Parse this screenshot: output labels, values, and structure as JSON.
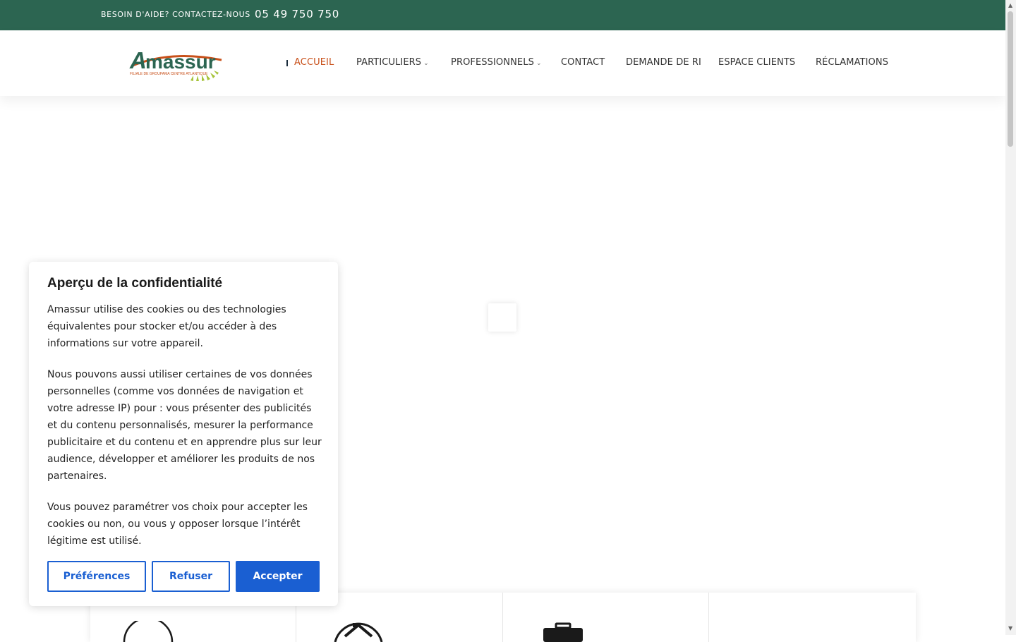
{
  "topbar": {
    "help_text": "BESOIN D'AIDE? CONTACTEZ-NOUS",
    "phone": "05 49 750 750"
  },
  "logo": {
    "name": "Amassur",
    "tagline": "FILIALE DE GROUPAMA CENTRE ATLANTIQUE"
  },
  "nav": {
    "items": [
      {
        "label": "ACCUEIL",
        "active": true
      },
      {
        "label": "PARTICULIERS",
        "dropdown": true
      },
      {
        "label": "PROFESSIONNELS",
        "dropdown": true
      },
      {
        "label": "CONTACT"
      },
      {
        "label": "DEMANDE DE RI"
      },
      {
        "label": "ESPACE CLIENTS"
      },
      {
        "label": "RÉCLAMATIONS"
      }
    ]
  },
  "cookie": {
    "title": "Aperçu de la confidentialité",
    "paragraph1": "Amassur utilise des cookies ou des technologies équivalentes pour stocker et/ou accéder à des informations sur votre appareil.",
    "paragraph2": "Nous pouvons aussi utiliser certaines de vos données personnelles (comme vos données de navigation et votre adresse IP) pour : vous présenter des publicités et du contenu personnalisés, mesurer la performance publicitaire et du contenu et en apprendre plus sur leur audience, développer et améliorer les produits de nos partenaires.",
    "paragraph3": "Vous pouvez paramétrer vos choix pour accepter les cookies ou non, ou vous y opposer lorsque l’intérêt légitime est utilisé.",
    "buttons": {
      "preferences": "Préférences",
      "refuse": "Refuser",
      "accept": "Accepter"
    }
  },
  "colors": {
    "topbar": "#2c6551",
    "active_nav": "#c8501a",
    "cookie_button": "#1a5fd2"
  },
  "icons": [
    "chevron-down-icon",
    "person-icon",
    "house-icon",
    "briefcase-icon"
  ]
}
